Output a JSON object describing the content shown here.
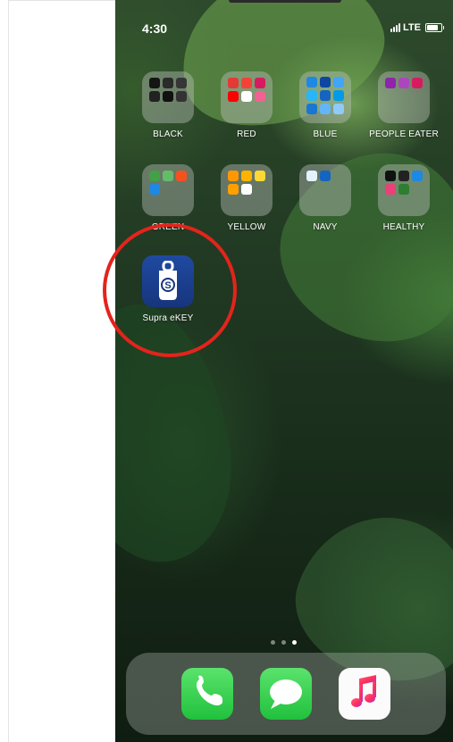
{
  "status_bar": {
    "time": "4:30",
    "network": "LTE",
    "icons": [
      "signal-icon",
      "battery-icon"
    ]
  },
  "folders": [
    {
      "label": "BLACK",
      "icons": [
        "black-app-icon",
        "black-app-icon",
        "black-app-icon",
        "black-app-icon",
        "black-app-icon",
        "black-app-icon"
      ]
    },
    {
      "label": "RED",
      "icons": [
        "red-app-icon",
        "red-app-icon",
        "red-app-icon",
        "red-app-icon",
        "red-app-icon",
        "red-app-icon"
      ]
    },
    {
      "label": "BLUE",
      "icons": [
        "blue-app-icon",
        "blue-app-icon",
        "blue-app-icon",
        "blue-app-icon",
        "blue-app-icon",
        "blue-app-icon",
        "blue-app-icon",
        "blue-app-icon",
        "blue-app-icon"
      ]
    },
    {
      "label": "PEOPLE EATER",
      "icons": [
        "purple-app-icon",
        "purple-app-icon",
        "purple-app-icon"
      ]
    },
    {
      "label": "GREEN",
      "icons": [
        "green-app-icon",
        "green-app-icon",
        "green-app-icon",
        "green-app-icon"
      ]
    },
    {
      "label": "YELLOW",
      "icons": [
        "yellow-app-icon",
        "yellow-app-icon",
        "yellow-app-icon",
        "yellow-app-icon",
        "yellow-app-icon"
      ]
    },
    {
      "label": "NAVY",
      "icons": [
        "navy-app-icon",
        "navy-app-icon"
      ]
    },
    {
      "label": "HEALTHY",
      "icons": [
        "health-app-icon",
        "health-app-icon",
        "health-app-icon",
        "health-app-icon",
        "health-app-icon"
      ]
    }
  ],
  "featured_app": {
    "label": "Supra eKEY",
    "icon": "supra-ekey-lockbox-icon",
    "highlight_color": "#e3241c"
  },
  "page_indicator": {
    "pages": 3,
    "current_page": 3
  },
  "dock": {
    "apps": [
      {
        "name": "phone-app",
        "icon": "phone-icon"
      },
      {
        "name": "messages-app",
        "icon": "speech-bubble-icon"
      },
      {
        "name": "music-app",
        "icon": "music-note-icon"
      }
    ]
  },
  "colors": {
    "highlight_red": "#e3241c",
    "supra_blue": "#1f4aa0",
    "green_app": "#24c640"
  }
}
